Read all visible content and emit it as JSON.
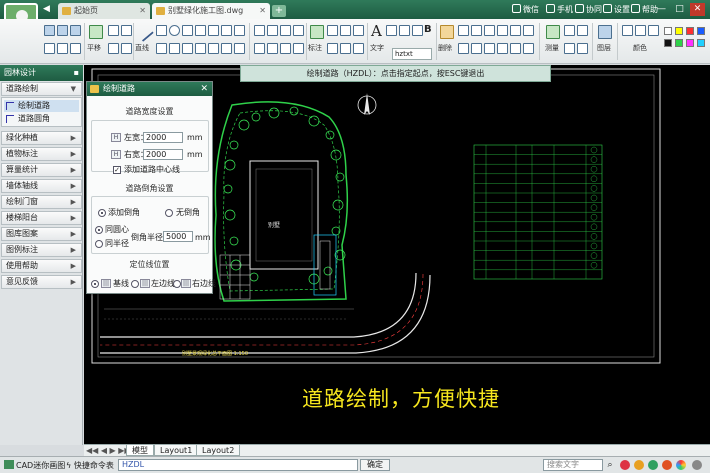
{
  "titlebar": {
    "tabs": [
      {
        "label": "起始页"
      },
      {
        "label": "别墅绿化施工图.dwg"
      }
    ],
    "menus": [
      {
        "label": "微信"
      },
      {
        "label": "手机"
      },
      {
        "label": "协同"
      },
      {
        "label": "设置"
      },
      {
        "label": "帮助"
      }
    ]
  },
  "toolbar": {
    "labels": {
      "pan": "平移",
      "line": "直线",
      "dim": "标注",
      "text": "文字",
      "delete": "删除",
      "measure": "测量",
      "layer": "图层",
      "color": "颜色"
    },
    "font_value": "hztxt",
    "swatches": [
      "#ffffff",
      "#ffff00",
      "#ff3030",
      "#1a5cff",
      "#111111",
      "#2fd14a",
      "#ff30ff",
      "#20d0ff"
    ]
  },
  "panel": {
    "title": "园林设计",
    "top_category": "道路绘制",
    "sub_items": [
      {
        "label": "绘制道路"
      },
      {
        "label": "道路圆角"
      }
    ],
    "categories": [
      {
        "label": "绿化种植"
      },
      {
        "label": "植物标注"
      },
      {
        "label": "算量统计"
      },
      {
        "label": "墙体轴线"
      },
      {
        "label": "绘制门窗"
      },
      {
        "label": "楼梯阳台"
      },
      {
        "label": "图库图案"
      },
      {
        "label": "图例标注"
      },
      {
        "label": "使用帮助"
      },
      {
        "label": "意见反馈"
      }
    ]
  },
  "prompt": "绘制道路（HZDL）：点击指定起点，按ESC键退出",
  "dialog": {
    "title": "绘制道路",
    "section_width": "道路宽度设置",
    "left_label": "左宽：",
    "left_value": "2000",
    "right_label": "右宽：",
    "right_value": "2000",
    "unit": "mm",
    "center_line": "添加道路中心线",
    "section_corner": "道路倒角设置",
    "add_corner": "添加倒角",
    "no_corner": "无倒角",
    "same_circle": "同圆心",
    "same_radius": "同半径",
    "radius_label": "倒角半径：",
    "radius_value": "5000",
    "section_position": "定位线位置",
    "pos_base": "基线",
    "pos_left": "左边线",
    "pos_right": "右边线"
  },
  "drawing": {
    "building_label": "别墅",
    "plan_caption": "别墅景观绿化总平面图 1:150",
    "promo": "道路绘制，方便快捷"
  },
  "layout_tabs": [
    {
      "label": "模型"
    },
    {
      "label": "Layout1"
    },
    {
      "label": "Layout2"
    }
  ],
  "statusbar": {
    "logo": "CAD迷你画图",
    "cmd_label": "快捷命令表",
    "cmd_value": "HZDL",
    "ok": "确定",
    "search_placeholder": "搜索文字"
  }
}
